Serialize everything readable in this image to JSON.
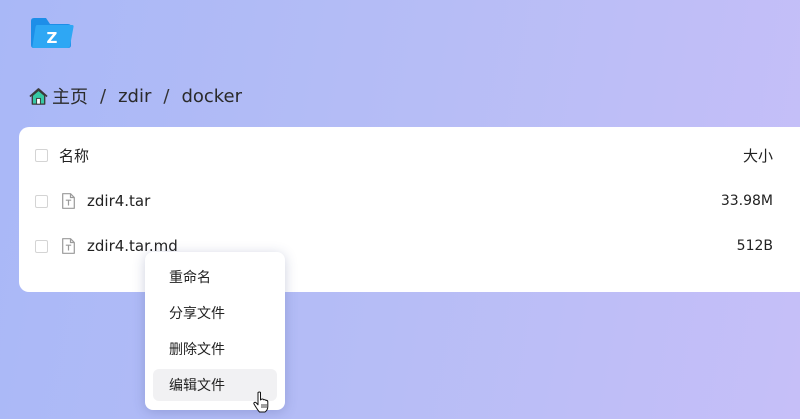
{
  "app": {
    "logo_letter": "Z",
    "brand_color": "#2496ed"
  },
  "breadcrumb": {
    "home_icon": "home-icon",
    "home_label": "主页",
    "separator": "/",
    "items": [
      "zdir",
      "docker"
    ]
  },
  "file_table": {
    "header": {
      "name": "名称",
      "size": "大小"
    },
    "rows": [
      {
        "name": "zdir4.tar",
        "size": "33.98M",
        "icon": "text-file-icon"
      },
      {
        "name": "zdir4.tar.md",
        "size": "512B",
        "icon": "text-file-icon"
      }
    ]
  },
  "context_menu": {
    "items": [
      {
        "label": "重命名"
      },
      {
        "label": "分享文件"
      },
      {
        "label": "删除文件"
      },
      {
        "label": "编辑文件",
        "hovered": true
      }
    ]
  },
  "cursor": {
    "icon": "hand-pointer-icon"
  }
}
